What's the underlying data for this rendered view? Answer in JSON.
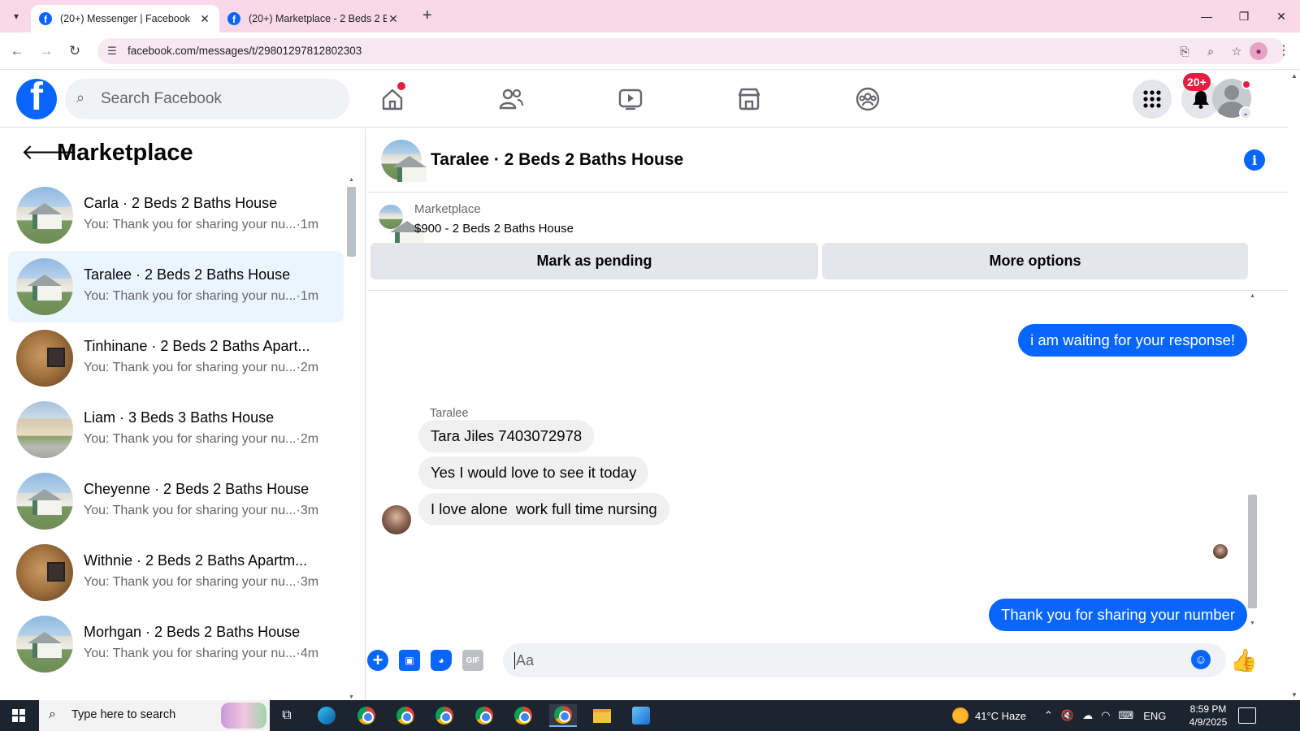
{
  "browser": {
    "tabs": [
      {
        "title": "(20+) Messenger | Facebook",
        "active": true
      },
      {
        "title": "(20+) Marketplace - 2 Beds 2 Ba",
        "active": false
      }
    ],
    "url": "facebook.com/messages/t/29801297812802303"
  },
  "fb_header": {
    "search_placeholder": "Search Facebook",
    "notification_badge": "20+"
  },
  "sidebar": {
    "title": "Marketplace",
    "conversations": [
      {
        "name": "Carla · 2 Beds 2 Baths House",
        "preview": "You: Thank you for sharing your nu...·1m",
        "thumb": "house",
        "selected": false
      },
      {
        "name": "Taralee · 2 Beds 2 Baths House",
        "preview": "You: Thank you for sharing your nu...·1m",
        "thumb": "house",
        "selected": true
      },
      {
        "name": "Tinhinane · 2 Beds 2 Baths Apart...",
        "preview": "You: Thank you for sharing your nu...·2m",
        "thumb": "room",
        "selected": false
      },
      {
        "name": "Liam · 3 Beds 3 Baths House",
        "preview": "You: Thank you for sharing your nu...·2m",
        "thumb": "big-house",
        "selected": false
      },
      {
        "name": "Cheyenne · 2 Beds 2 Baths House",
        "preview": "You: Thank you for sharing your nu...·3m",
        "thumb": "house",
        "selected": false
      },
      {
        "name": "Withnie · 2 Beds 2 Baths Apartm...",
        "preview": "You: Thank you for sharing your nu...·3m",
        "thumb": "room",
        "selected": false
      },
      {
        "name": "Morhgan · 2 Beds 2 Baths House",
        "preview": "You: Thank you for sharing your nu...·4m",
        "thumb": "house",
        "selected": false
      }
    ]
  },
  "chat": {
    "title": "Taralee · 2 Beds 2 Baths House",
    "listing": {
      "label": "Marketplace",
      "price_title": "$900 - 2 Beds 2 Baths House",
      "mark_pending": "Mark as pending",
      "more_options": "More options"
    },
    "messages": {
      "out_1": "i am waiting for your response!",
      "sender": "Taralee",
      "in_1": "Tara Jiles 7403072978",
      "in_2": "Yes I would love to see it today",
      "in_3": "I love alone  work full time nursing",
      "out_2": "Thank you for sharing your number"
    },
    "composer": {
      "placeholder": "Aa",
      "gif_label": "GIF"
    }
  },
  "taskbar": {
    "search_placeholder": "Type here to search",
    "weather": "41°C  Haze",
    "language": "ENG",
    "time": "8:59 PM",
    "date": "4/9/2025"
  },
  "colors": {
    "fb_blue": "#0866ff",
    "tab_bar_pink": "#f9d9e8",
    "selected_conv": "#ebf5ff",
    "badge_red": "#e41e3f"
  }
}
